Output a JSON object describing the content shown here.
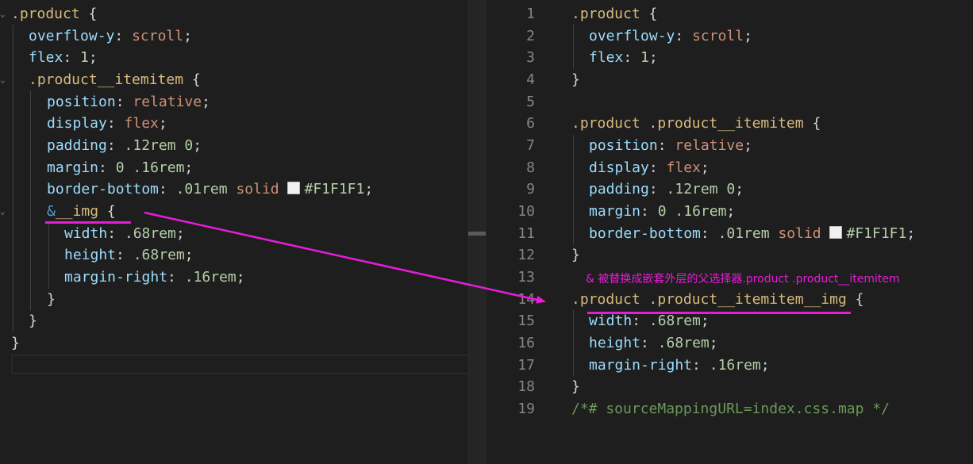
{
  "colors": {
    "background": "#1e1e1e",
    "selector": "#d7ba7d",
    "property": "#9cdcfe",
    "value": "#ce9178",
    "number": "#b5cea8",
    "comment": "#6a9955",
    "annotation": "#e81cd8"
  },
  "left": {
    "l1": {
      "sel": ".product",
      "brace": " {"
    },
    "l2": {
      "prop": "overflow-y",
      "colon": ": ",
      "val": "scroll",
      "semi": ";"
    },
    "l3": {
      "prop": "flex",
      "colon": ": ",
      "num": "1",
      "semi": ";"
    },
    "l4": {
      "sel": ".product__itemitem",
      "brace": " {"
    },
    "l5": {
      "prop": "position",
      "colon": ": ",
      "val": "relative",
      "semi": ";"
    },
    "l6": {
      "prop": "display",
      "colon": ": ",
      "val": "flex",
      "semi": ";"
    },
    "l7": {
      "prop": "padding",
      "colon": ": ",
      "num": ".12rem 0",
      "semi": ";"
    },
    "l8": {
      "prop": "margin",
      "colon": ": ",
      "num": "0 .16rem",
      "semi": ";"
    },
    "l9": {
      "prop": "border-bottom",
      "colon": ": ",
      "num": ".01rem",
      "val": "solid",
      "color": "#F1F1F1",
      "semi": ";"
    },
    "l10": {
      "amp": "&",
      "sel": "__img",
      "brace": " {"
    },
    "l11": {
      "prop": "width",
      "colon": ": ",
      "num": ".68rem",
      "semi": ";"
    },
    "l12": {
      "prop": "height",
      "colon": ": ",
      "num": ".68rem",
      "semi": ";"
    },
    "l13": {
      "prop": "margin-right",
      "colon": ": ",
      "num": ".16rem",
      "semi": ";"
    },
    "close": "}"
  },
  "right": {
    "line_numbers": [
      "1",
      "2",
      "3",
      "4",
      "5",
      "6",
      "7",
      "8",
      "9",
      "10",
      "11",
      "12",
      "13",
      "14",
      "15",
      "16",
      "17",
      "18",
      "19"
    ],
    "r1": {
      "sel": ".product",
      "brace": " {"
    },
    "r2": {
      "prop": "overflow-y",
      "colon": ": ",
      "val": "scroll",
      "semi": ";"
    },
    "r3": {
      "prop": "flex",
      "colon": ": ",
      "num": "1",
      "semi": ";"
    },
    "r6": {
      "sel": ".product .product__itemitem",
      "brace": " {"
    },
    "r7": {
      "prop": "position",
      "colon": ": ",
      "val": "relative",
      "semi": ";"
    },
    "r8": {
      "prop": "display",
      "colon": ": ",
      "val": "flex",
      "semi": ";"
    },
    "r9": {
      "prop": "padding",
      "colon": ": ",
      "num": ".12rem 0",
      "semi": ";"
    },
    "r10": {
      "prop": "margin",
      "colon": ": ",
      "num": "0 .16rem",
      "semi": ";"
    },
    "r11": {
      "prop": "border-bottom",
      "colon": ": ",
      "num": ".01rem",
      "val": "solid",
      "color": "#F1F1F1",
      "semi": ";"
    },
    "r14": {
      "sel": ".product .product__itemitem__img",
      "brace": " {"
    },
    "r15": {
      "prop": "width",
      "colon": ": ",
      "num": ".68rem",
      "semi": ";"
    },
    "r16": {
      "prop": "height",
      "colon": ": ",
      "num": ".68rem",
      "semi": ";"
    },
    "r17": {
      "prop": "margin-right",
      "colon": ": ",
      "num": ".16rem",
      "semi": ";"
    },
    "r19": {
      "comment": "/*# sourceMappingURL=index.css.map */"
    },
    "close": "}"
  },
  "annotation": "& 被替换成嵌套外层的父选择器.product .product__itemitem"
}
